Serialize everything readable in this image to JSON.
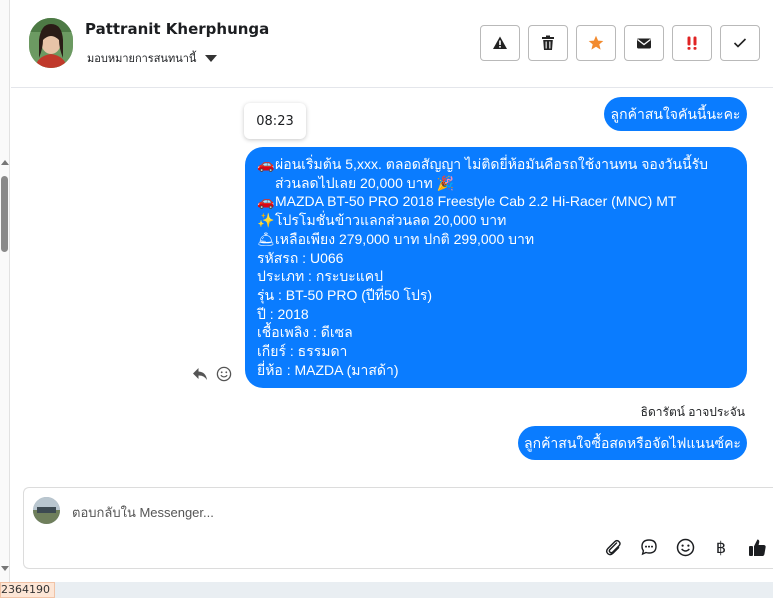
{
  "contact": {
    "name": "Pattranit Kherphunga",
    "assign_label": "มอบหมายการสนทนานี้"
  },
  "header_actions": [
    {
      "icon": "warning-icon"
    },
    {
      "icon": "trash-icon"
    },
    {
      "icon": "star-icon",
      "color": "#f28a2e"
    },
    {
      "icon": "mail-icon"
    },
    {
      "icon": "priority-icon",
      "color": "#e02424"
    },
    {
      "icon": "check-icon"
    }
  ],
  "chat": {
    "time_chip": "08:23",
    "message_1": "ลูกค้าสนใจคันนี้นะคะ",
    "message_2": {
      "lines": [
        {
          "emoji": "🚗",
          "text": "ผ่อนเริ่มต้น 5,xxx. ตลอดสัญญา ไม่ติดยี่ห้อมันคือรถใช้งานทน จองวันนี้รับส่วนลดไปเลย 20,000 บาท 🎉"
        },
        {
          "emoji": "🚗",
          "text": "MAZDA BT-50 PRO 2018 Freestyle Cab 2.2 Hi-Racer (MNC) MT"
        },
        {
          "emoji": "✨",
          "text": "โปรโมชั่นข้าวแลกส่วนลด 20,000 บาท"
        },
        {
          "emoji": "🛎",
          "text": "เหลือเพียง 279,000 บาท ปกติ 299,000 บาท"
        },
        {
          "emoji": "",
          "text": "รหัสรถ : U066"
        },
        {
          "emoji": "",
          "text": "ประเภท : กระบะแคป"
        },
        {
          "emoji": "",
          "text": "รุ่น : BT-50 PRO (ปีที่50 โปร)"
        },
        {
          "emoji": "",
          "text": "ปี : 2018"
        },
        {
          "emoji": "",
          "text": "เชื้อเพลิง : ดีเซล"
        },
        {
          "emoji": "",
          "text": "เกียร์ : ธรรมดา"
        },
        {
          "emoji": "",
          "text": "ยี่ห้อ : MAZDA (มาสด้า)"
        }
      ]
    },
    "sender_name": "ธิดารัตน์ อาจประจัน",
    "message_3": "ลูกค้าสนใจซื้อสดหรือจัดไฟแนนซ์คะ",
    "bubble_color": "#0a7cff"
  },
  "composer": {
    "placeholder": "ตอบกลับใน Messenger...",
    "tools": [
      {
        "icon": "paperclip-icon"
      },
      {
        "icon": "chat-bubble-icon"
      },
      {
        "icon": "smiley-icon"
      },
      {
        "icon": "baht-icon",
        "glyph": "฿"
      },
      {
        "icon": "thumbs-up-icon"
      }
    ]
  },
  "footer": {
    "id_tag": "2364190"
  }
}
